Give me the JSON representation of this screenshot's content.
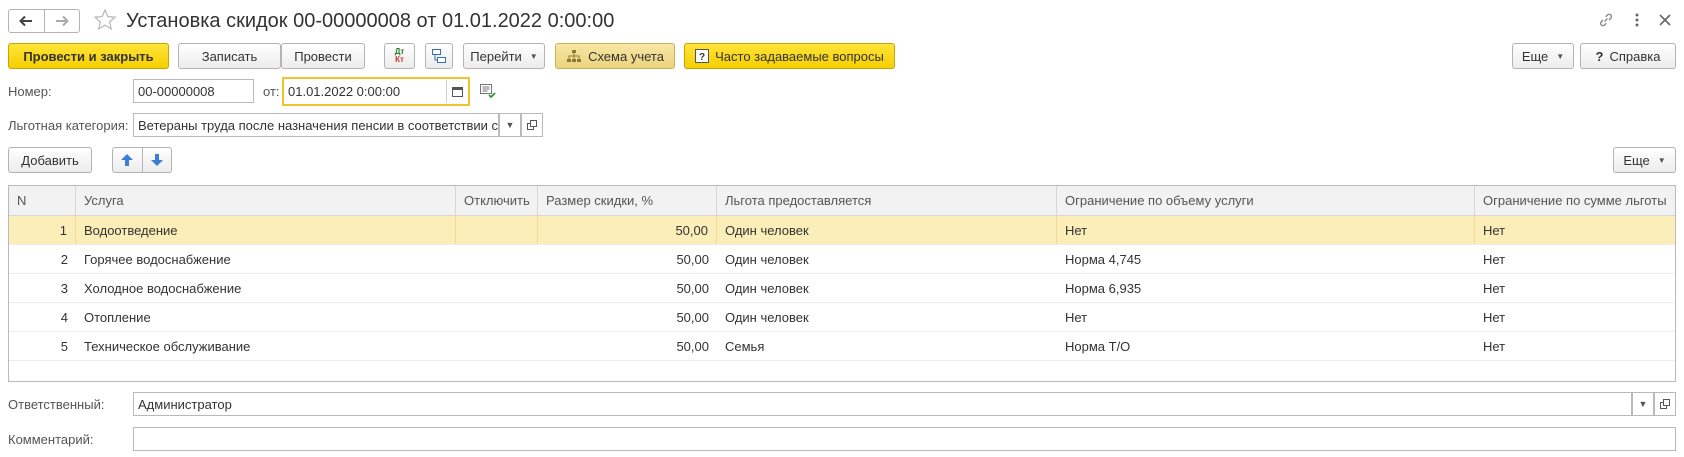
{
  "window": {
    "title": "Установка скидок 00-00000008 от 01.01.2022 0:00:00"
  },
  "toolbar": {
    "post_and_close": "Провести и закрыть",
    "save": "Записать",
    "post": "Провести",
    "dtkt_top": "Дт",
    "dtkt_bottom": "Кт",
    "goto": "Перейти",
    "accounting_scheme": "Схема учета",
    "faq": "Часто задаваемые вопросы",
    "more": "Еще",
    "help": "Справка"
  },
  "form": {
    "number_label": "Номер:",
    "number_value": "00-00000008",
    "date_label": "от:",
    "date_value": "01.01.2022  0:00:00",
    "category_label": "Льготная категория:",
    "category_value": "Ветераны труда после назначения  пенсии в соответствии с"
  },
  "table_toolbar": {
    "add": "Добавить",
    "more": "Еще"
  },
  "table": {
    "columns": [
      "N",
      "Услуга",
      "Отключить",
      "Размер скидки, %",
      "Льгота предоставляется",
      "Ограничение по объему услуги",
      "Ограничение по сумме льготы"
    ],
    "rows": [
      {
        "n": "1",
        "service": "Водоотведение",
        "disable": "",
        "discount": "50,00",
        "granted": "Один человек",
        "volume_limit": "Нет",
        "sum_limit": "Нет"
      },
      {
        "n": "2",
        "service": "Горячее водоснабжение",
        "disable": "",
        "discount": "50,00",
        "granted": "Один человек",
        "volume_limit": "Норма 4,745",
        "sum_limit": "Нет"
      },
      {
        "n": "3",
        "service": "Холодное водоснабжение",
        "disable": "",
        "discount": "50,00",
        "granted": "Один человек",
        "volume_limit": "Норма 6,935",
        "sum_limit": "Нет"
      },
      {
        "n": "4",
        "service": "Отопление",
        "disable": "",
        "discount": "50,00",
        "granted": "Один человек",
        "volume_limit": "Нет",
        "sum_limit": "Нет"
      },
      {
        "n": "5",
        "service": "Техническое обслуживание",
        "disable": "",
        "discount": "50,00",
        "granted": "Семья",
        "volume_limit": "Норма Т/О",
        "sum_limit": "Нет"
      }
    ]
  },
  "footer": {
    "responsible_label": "Ответственный:",
    "responsible_value": "Администратор",
    "comment_label": "Комментарий:",
    "comment_value": ""
  },
  "colors": {
    "primary": "#f5cf00",
    "selected_row": "#fbeeb8",
    "focus_border": "#f2c12e"
  },
  "icons": {
    "back": "arrow-left-icon",
    "forward": "arrow-right-icon",
    "favorite": "star-icon",
    "link": "link-icon",
    "menu": "vertical-dots-icon",
    "close": "close-icon",
    "calendar": "calendar-icon",
    "move_up": "arrow-up-icon",
    "move_down": "arrow-down-icon"
  }
}
